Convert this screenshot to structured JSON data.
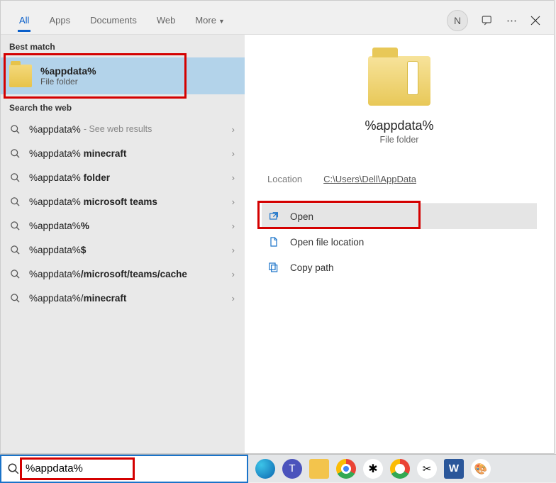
{
  "tabs": {
    "all": "All",
    "apps": "Apps",
    "documents": "Documents",
    "web": "Web",
    "more": "More"
  },
  "user_initial": "N",
  "sections": {
    "best_match": "Best match",
    "search_web": "Search the web"
  },
  "best_match": {
    "title": "%appdata%",
    "subtitle": "File folder"
  },
  "web_results": [
    {
      "prefix": "%appdata%",
      "suffix": "",
      "hint": " - See web results"
    },
    {
      "prefix": "%appdata%",
      "suffix": " minecraft",
      "hint": ""
    },
    {
      "prefix": "%appdata%",
      "suffix": " folder",
      "hint": ""
    },
    {
      "prefix": "%appdata%",
      "suffix": " microsoft teams",
      "hint": ""
    },
    {
      "prefix": "%appdata%",
      "suffix": "%",
      "hint": ""
    },
    {
      "prefix": "%appdata%",
      "suffix": "$",
      "hint": ""
    },
    {
      "prefix": "%appdata%",
      "suffix": "/microsoft/teams/cache",
      "hint": ""
    },
    {
      "prefix": "%appdata%/",
      "suffix": "minecraft",
      "hint": ""
    }
  ],
  "preview": {
    "title": "%appdata%",
    "subtitle": "File folder",
    "location_label": "Location",
    "location_path": "C:\\Users\\Dell\\AppData"
  },
  "actions": {
    "open": "Open",
    "open_location": "Open file location",
    "copy_path": "Copy path"
  },
  "search_input": "%appdata%",
  "taskbar_apps": [
    "edge",
    "teams",
    "explorer",
    "chrome",
    "slack",
    "chrome2",
    "snip",
    "word",
    "paint"
  ]
}
